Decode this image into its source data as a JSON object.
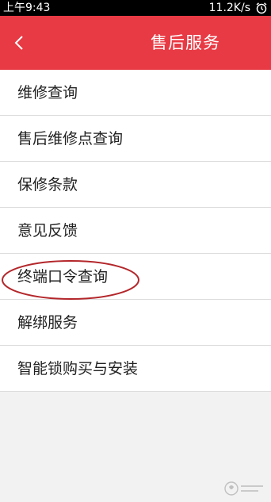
{
  "status_bar": {
    "time": "上午9:43",
    "network_speed": "11.2K/s",
    "alarm_icon": "alarm-clock-icon"
  },
  "header": {
    "title": "售后服务",
    "back_icon": "chevron-left-icon",
    "background_color": "#e83a44"
  },
  "menu": {
    "items": [
      {
        "label": "维修查询"
      },
      {
        "label": "售后维修点查询"
      },
      {
        "label": "保修条款"
      },
      {
        "label": "意见反馈"
      },
      {
        "label": "终端口令查询"
      },
      {
        "label": "解绑服务"
      },
      {
        "label": "智能锁购买与安装"
      }
    ]
  },
  "annotation": {
    "highlighted_item": "终端口令查询",
    "highlight_color": "#b3262a"
  }
}
